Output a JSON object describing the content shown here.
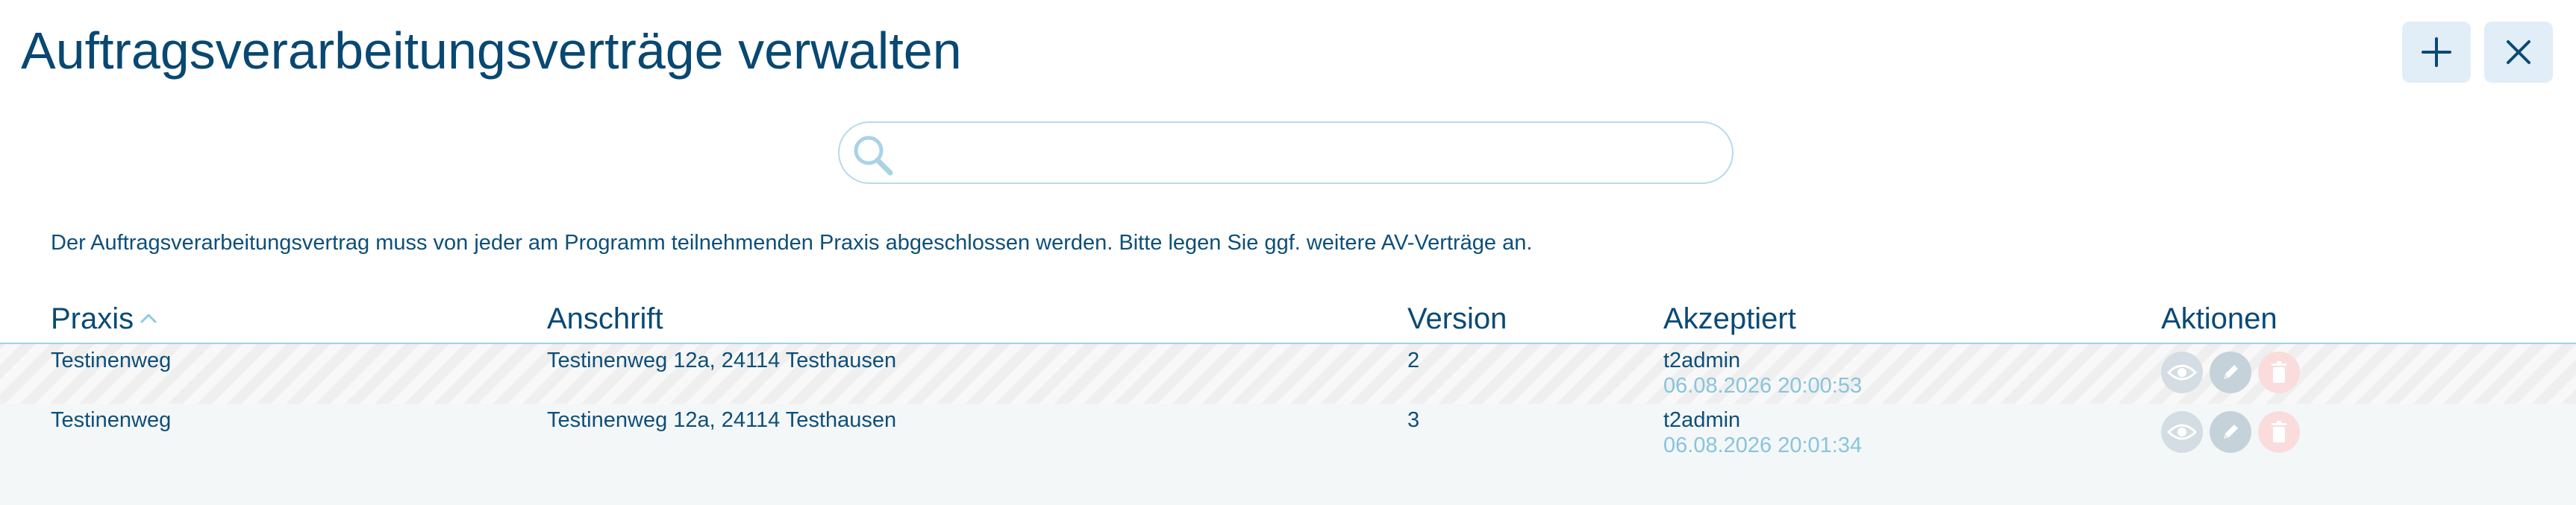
{
  "header": {
    "title": "Auftragsverarbeitungsverträge verwalten"
  },
  "search": {
    "value": "",
    "placeholder": ""
  },
  "info_text": "Der Auftragsverarbeitungsvertrag muss von jeder am Programm teilnehmenden Praxis abgeschlossen werden. Bitte legen Sie ggf. weitere AV-Verträge an.",
  "table": {
    "columns": {
      "praxis": "Praxis",
      "anschrift": "Anschrift",
      "version": "Version",
      "akzeptiert": "Akzeptiert",
      "aktionen": "Aktionen"
    },
    "sort": {
      "column": "praxis",
      "direction": "ascending"
    },
    "rows": [
      {
        "praxis": "Testinenweg",
        "anschrift": "Testinenweg 12a, 24114 Testhausen",
        "version": "2",
        "akzeptiert_user": "t2admin",
        "akzeptiert_date": "06.08.2026 20:00:53"
      },
      {
        "praxis": "Testinenweg",
        "anschrift": "Testinenweg 12a, 24114 Testhausen",
        "version": "3",
        "akzeptiert_user": "t2admin",
        "akzeptiert_date": "06.08.2026 20:01:34"
      }
    ]
  },
  "icons": {
    "add": "plus-icon",
    "close": "close-icon",
    "search": "search-icon",
    "sort": "chevron-up-icon",
    "view": "eye-icon",
    "edit": "pencil-icon",
    "delete": "trash-icon"
  },
  "colors": {
    "primary": "#084872",
    "accent_light": "#e1eef7",
    "divider": "#9fd3e8",
    "date_text": "#88c4dc",
    "delete_bg": "#fadcdc"
  }
}
